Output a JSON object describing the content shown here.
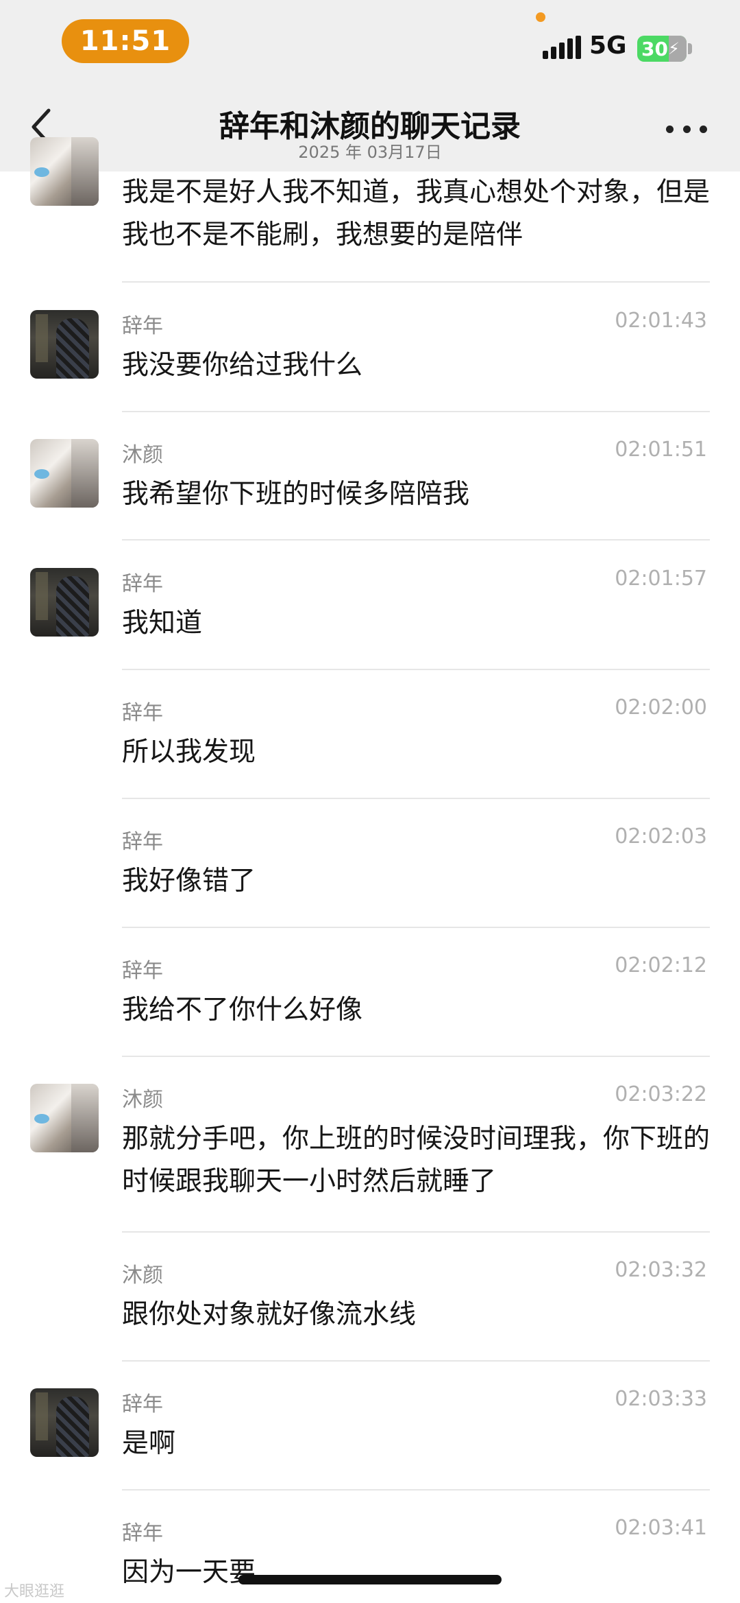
{
  "status_bar": {
    "time": "11:51",
    "network": "5G",
    "battery": "30",
    "battery_icon": "charging-bolt-icon",
    "signal_icon": "signal-bars-icon"
  },
  "nav": {
    "title": "辞年和沐颜的聊天记录",
    "subtitle": "2025 年 03月17日",
    "back_icon": "chevron-left-icon",
    "more_icon": "more-dots-icon"
  },
  "messages": [
    {
      "sender": "",
      "time": "",
      "text": "我是不是好人我不知道，我真心想处个对象，但是我也不是不能刷，我想要的是陪伴",
      "avatar": "cat"
    },
    {
      "sender": "辞年",
      "time": "02:01:43",
      "text": "我没要你给过我什么",
      "avatar": "dark"
    },
    {
      "sender": "沐颜",
      "time": "02:01:51",
      "text": "我希望你下班的时候多陪陪我",
      "avatar": "cat"
    },
    {
      "sender": "辞年",
      "time": "02:01:57",
      "text": "我知道",
      "avatar": "dark"
    },
    {
      "sender": "辞年",
      "time": "02:02:00",
      "text": "所以我发现",
      "avatar": ""
    },
    {
      "sender": "辞年",
      "time": "02:02:03",
      "text": "我好像错了",
      "avatar": ""
    },
    {
      "sender": "辞年",
      "time": "02:02:12",
      "text": "我给不了你什么好像",
      "avatar": ""
    },
    {
      "sender": "沐颜",
      "time": "02:03:22",
      "text": "那就分手吧，你上班的时候没时间理我，你下班的时候跟我聊天一小时然后就睡了",
      "avatar": "cat"
    },
    {
      "sender": "沐颜",
      "time": "02:03:32",
      "text": "跟你处对象就好像流水线",
      "avatar": ""
    },
    {
      "sender": "辞年",
      "time": "02:03:33",
      "text": "是啊",
      "avatar": "dark"
    },
    {
      "sender": "辞年",
      "time": "02:03:41",
      "text": "因为一天要",
      "avatar": ""
    }
  ],
  "watermark": "大眼逛逛"
}
